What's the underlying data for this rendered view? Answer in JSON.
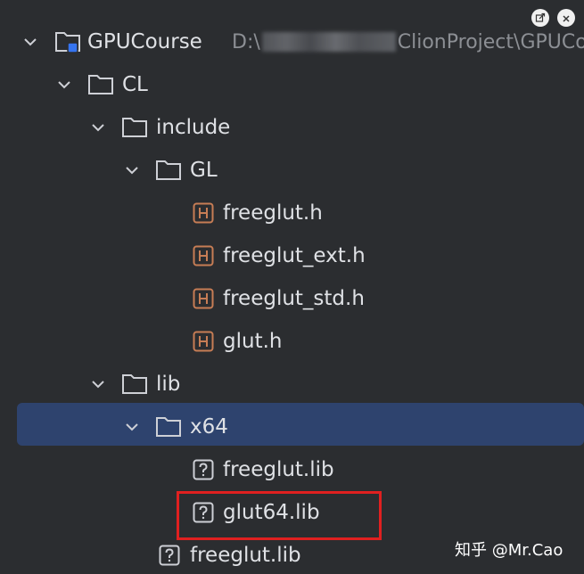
{
  "window": {
    "pin_button_icon": "pin-icon",
    "close_button_icon": "close-icon"
  },
  "tree": {
    "root": {
      "label": "GPUCourse",
      "path_prefix": "D:\\",
      "path_suffix": "ClionProject\\GPUCo",
      "icon": "project-module-icon",
      "expanded": true
    },
    "cl": {
      "label": "CL",
      "icon": "folder-icon",
      "expanded": true
    },
    "include": {
      "label": "include",
      "icon": "folder-icon",
      "expanded": true
    },
    "gl": {
      "label": "GL",
      "icon": "folder-icon",
      "expanded": true
    },
    "files_gl": [
      {
        "label": "freeglut.h",
        "icon": "header-file-icon"
      },
      {
        "label": "freeglut_ext.h",
        "icon": "header-file-icon"
      },
      {
        "label": "freeglut_std.h",
        "icon": "header-file-icon"
      },
      {
        "label": "glut.h",
        "icon": "header-file-icon"
      }
    ],
    "lib": {
      "label": "lib",
      "icon": "folder-icon",
      "expanded": true
    },
    "x64": {
      "label": "x64",
      "icon": "folder-icon",
      "expanded": true,
      "selected": true
    },
    "files_x64": [
      {
        "label": "freeglut.lib",
        "icon": "unknown-file-icon"
      },
      {
        "label": "glut64.lib",
        "icon": "unknown-file-icon",
        "highlighted": true
      }
    ],
    "files_lib": [
      {
        "label": "freeglut.lib",
        "icon": "unknown-file-icon"
      }
    ]
  },
  "watermark": {
    "text": "知乎 @Mr.Cao"
  },
  "colors": {
    "background": "#2b2d30",
    "selection": "#2e436e",
    "text": "#dfe1e5",
    "path_text": "#8c8f94",
    "header_icon": "#c77d55",
    "folder_icon": "#ced0d6",
    "highlight_box": "#e02020"
  }
}
